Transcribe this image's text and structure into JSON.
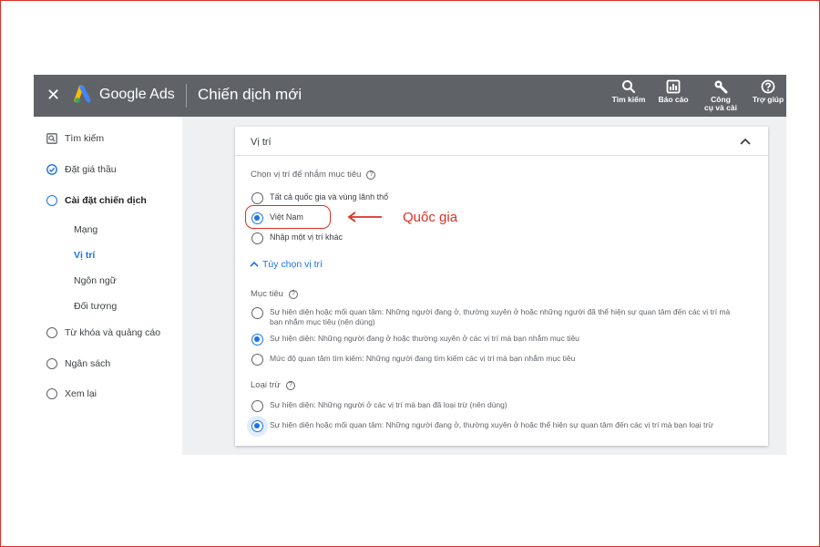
{
  "topbar": {
    "brand": "Google Ads",
    "campaign_title": "Chiến dịch mới",
    "tools": [
      {
        "label": "Tìm kiếm",
        "icon": "search-icon"
      },
      {
        "label": "Báo cáo",
        "icon": "report-icon"
      },
      {
        "label_line1": "Công",
        "label_line2": "cụ và cài",
        "icon": "wrench-icon"
      },
      {
        "label": "Trợ giúp",
        "icon": "help-icon"
      }
    ]
  },
  "sidebar": {
    "items": [
      {
        "label": "Tìm kiếm",
        "icon": "search-box-icon"
      },
      {
        "label": "Đặt giá thầu",
        "icon": "check-circle-icon"
      },
      {
        "label": "Cài đặt chiến dịch",
        "icon": "circle-icon"
      },
      {
        "label": "Từ khóa và quảng cáo",
        "icon": "circle-icon"
      },
      {
        "label": "Ngân sách",
        "icon": "circle-icon"
      },
      {
        "label": "Xem lại",
        "icon": "circle-icon"
      }
    ],
    "subitems": [
      {
        "label": "Mạng"
      },
      {
        "label": "Vị trí",
        "active": true
      },
      {
        "label": "Ngôn ngữ"
      },
      {
        "label": "Đối tượng"
      }
    ]
  },
  "card": {
    "title": "Vị trí",
    "target_label": "Chọn vị trí để nhắm mục tiêu",
    "location_options": [
      {
        "label": "Tất cả quốc gia và vùng lãnh thổ",
        "selected": false
      },
      {
        "label": "Việt Nam",
        "selected": true
      },
      {
        "label": "Nhập một vị trí khác",
        "selected": false
      }
    ],
    "options_link": "Tùy chọn vị trí",
    "target_section": "Mục tiêu",
    "target_options": [
      {
        "line1": "Sự hiện diện hoặc mối quan tâm: Những người đang ở, thường xuyên ở hoặc những người đã thể hiện sự quan tâm đến các vị trí mà",
        "line2": "bạn nhắm mục tiêu (nên dùng)",
        "selected": false
      },
      {
        "line1": "Sự hiện diện: Những người đang ở hoặc thường xuyên ở các vị trí mà bạn nhắm mục tiêu",
        "selected": true
      },
      {
        "line1": "Mức độ quan tâm tìm kiếm: Những người đang tìm kiếm các vị trí mà bạn nhắm mục tiêu",
        "selected": false
      }
    ],
    "exclude_section": "Loại trừ",
    "exclude_options": [
      {
        "line1": "Sự hiện diện: Những người ở các vị trí mà bạn đã loại trừ (nên dùng)",
        "selected": false
      },
      {
        "line1": "Sự hiện diện hoặc mối quan tâm: Những người đang ở, thường xuyên ở hoặc thể hiện sự quan tâm đến các vị trí mà bạn loại trừ",
        "selected": true
      }
    ]
  },
  "annotation": {
    "text": "Quốc gia",
    "color": "#d93025"
  },
  "colors": {
    "topbar": "#5f6368",
    "accent": "#1a73e8",
    "annotation": "#d93025"
  }
}
